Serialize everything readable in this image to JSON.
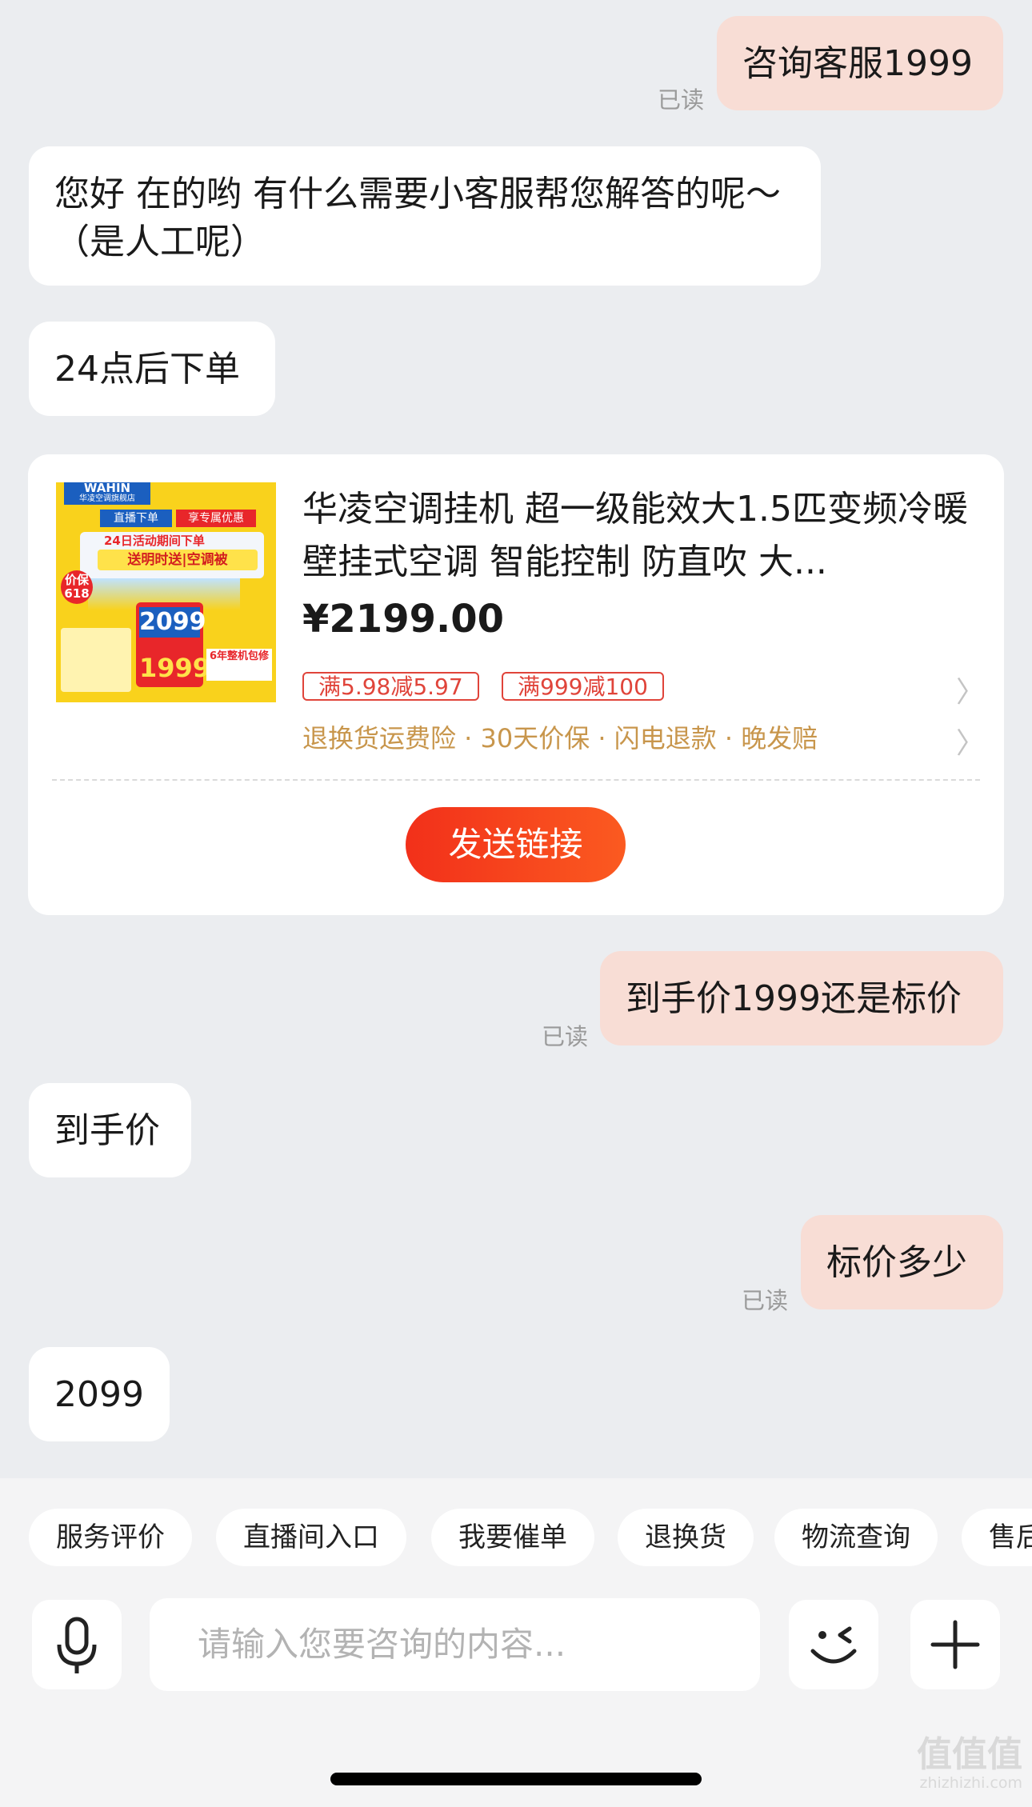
{
  "messages": [
    {
      "side": "right",
      "text": "咨询客服1999",
      "read": "已读"
    },
    {
      "side": "left",
      "text": "您好 在的哟 有什么需要小客服帮您解答的呢～（是人工呢）"
    },
    {
      "side": "left",
      "text": "24点后下单"
    },
    {
      "side": "right",
      "text": "到手价1999还是标价",
      "read": "已读"
    },
    {
      "side": "left",
      "text": "到手价"
    },
    {
      "side": "right",
      "text": "标价多少",
      "read": "已读"
    },
    {
      "side": "left",
      "text": "2099"
    }
  ],
  "product_card": {
    "thumb": {
      "brand": "WAHIN",
      "brand_sub": "华凌空调旗舰店",
      "tag1": "直播下单",
      "tag2": "享专属优惠",
      "headline": "24日活动期间下单",
      "headline2": "送明时送|空调被",
      "badge": "价保618",
      "price1": "2099",
      "price2": "1999",
      "note": "6年整机包修"
    },
    "title": "华凌空调挂机 超一级能效大1.5匹变频冷暖壁挂式空调 智能控制 防直吹 大...",
    "price": "¥2199.00",
    "coupons": [
      "满5.98减5.97",
      "满999减100"
    ],
    "services": "退换货运费险 · 30天价保 · 闪电退款 · 晚发赔",
    "send_button": "发送链接"
  },
  "quick_actions": [
    "服务评价",
    "直播间入口",
    "我要催单",
    "退换货",
    "物流查询",
    "售后"
  ],
  "input": {
    "placeholder": "请输入您要咨询的内容..."
  },
  "icons": {
    "voice": "microphone-icon",
    "emoji": "wink-face-icon",
    "more": "plus-icon"
  },
  "watermark": {
    "main": "值值值",
    "sub": "zhizhizhi.com"
  },
  "colors": {
    "background": "#ebedf0",
    "self_bubble": "#f8ddd5",
    "accent": "#f2301a",
    "service_text": "#c8964c"
  }
}
